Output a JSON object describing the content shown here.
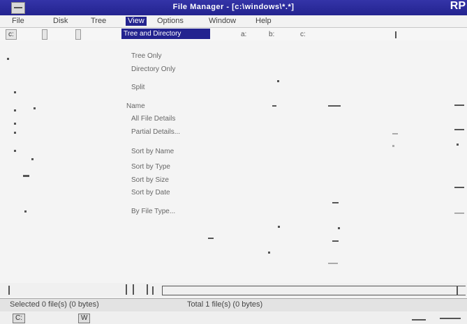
{
  "window": {
    "title": "File Manager - [c:\\windows\\*.*]",
    "corner_mark": "RP"
  },
  "menubar": {
    "items": [
      {
        "label": "File",
        "active": false
      },
      {
        "label": "Disk",
        "active": false
      },
      {
        "label": "Tree",
        "active": false
      },
      {
        "label": "View",
        "active": true
      },
      {
        "label": "Options",
        "active": false
      },
      {
        "label": "Window",
        "active": false
      },
      {
        "label": "Help",
        "active": false
      }
    ]
  },
  "toolbar": {
    "drive_label": "c:",
    "sel_label": "Tree and Directory",
    "drop_labels": [
      "a:",
      "b:",
      "c:"
    ]
  },
  "view_menu": {
    "items": [
      "Tree Only",
      "Directory Only",
      "Split",
      "Name",
      "All File Details",
      "Partial Details...",
      "Sort by Name",
      "Sort by Type",
      "Sort by Size",
      "Sort by Date",
      "By File Type..."
    ]
  },
  "status": {
    "left": "Selected 0 file(s) (0 bytes)",
    "right": "Total 1 file(s) (0 bytes)"
  },
  "taskbar": {
    "items": [
      "C:",
      "W"
    ]
  }
}
